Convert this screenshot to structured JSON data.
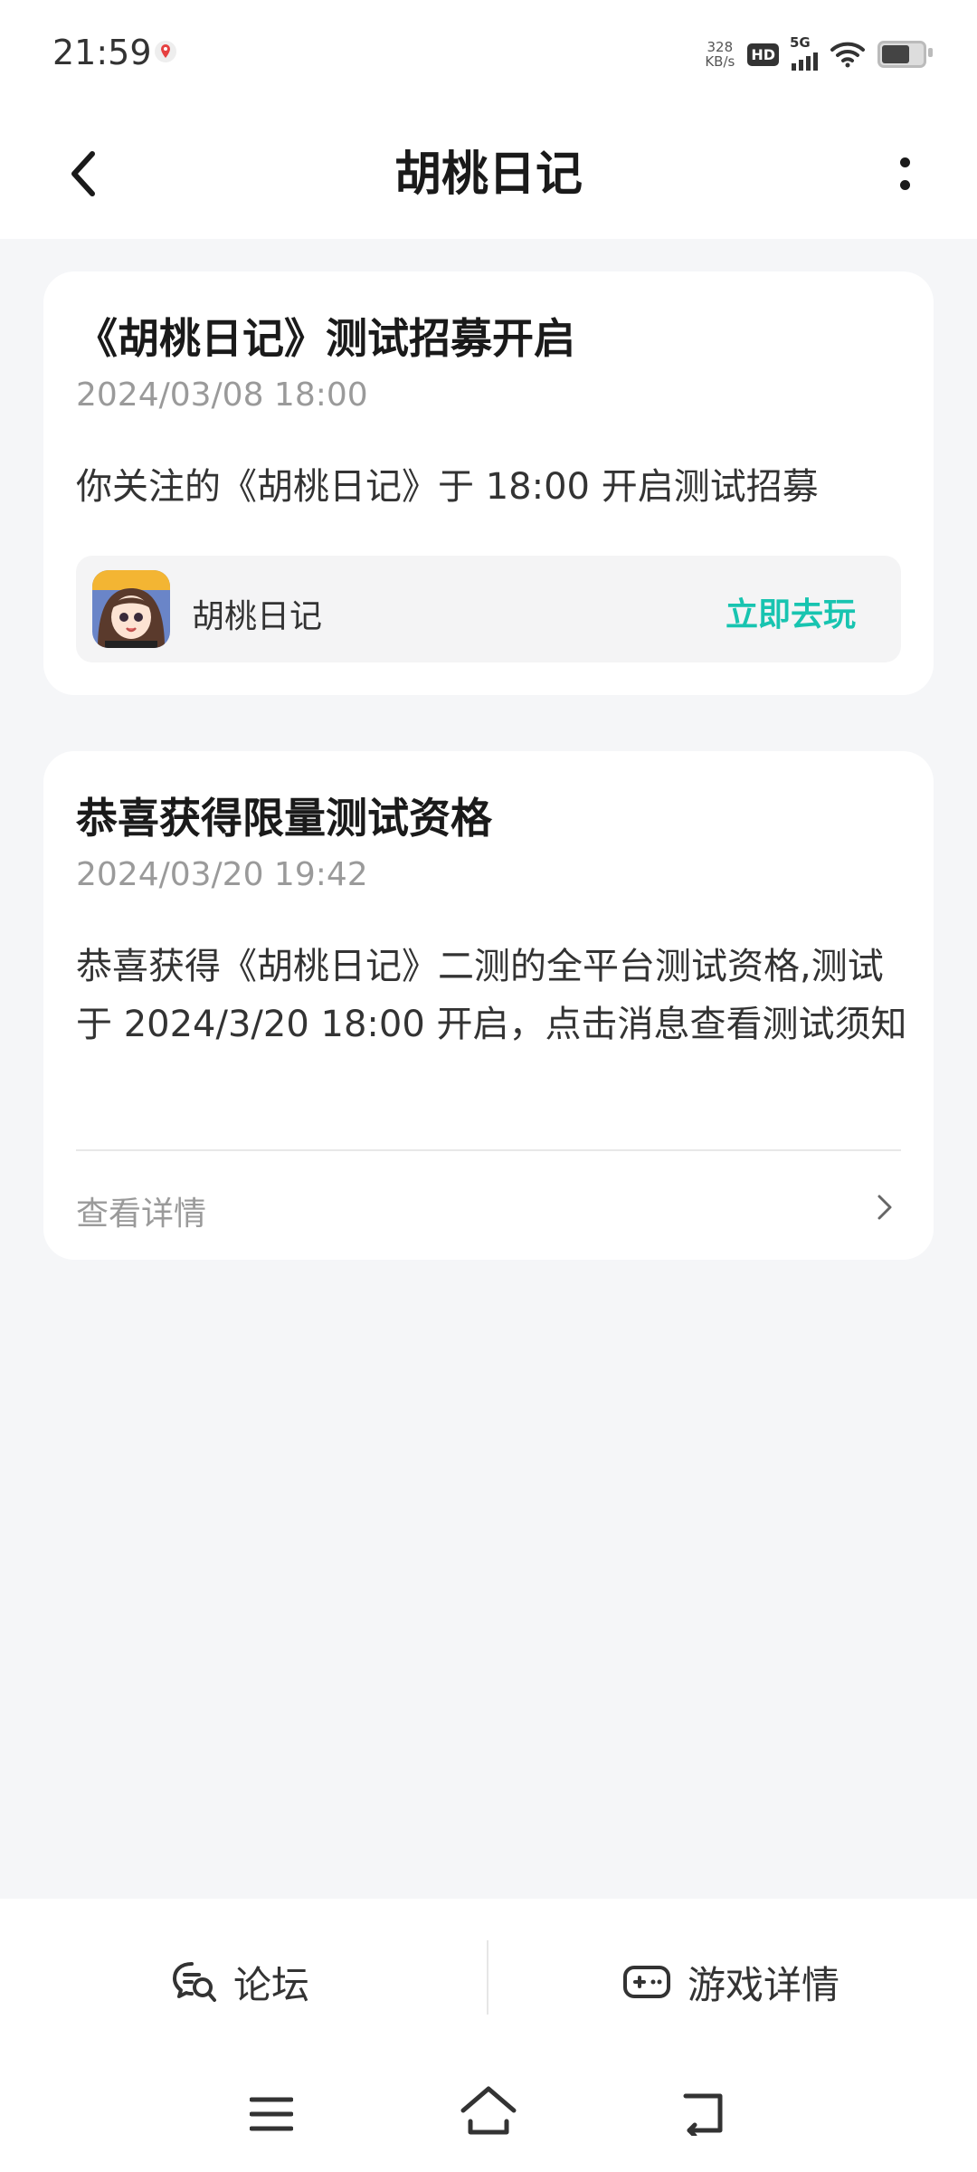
{
  "status_bar": {
    "time": "21:59",
    "net_speed_value": "328",
    "net_speed_unit": "KB/s",
    "hd_badge": "HD",
    "network_type": "5G",
    "icons": [
      "location-icon",
      "hd-icon",
      "signal-icon",
      "wifi-icon",
      "battery-icon"
    ]
  },
  "header": {
    "title": "胡桃日记",
    "back_icon": "back-arrow-icon",
    "more_icon": "more-vertical-icon"
  },
  "messages": [
    {
      "title": "《胡桃日记》测试招募开启",
      "time": "2024/03/08 18:00",
      "body": "你关注的《胡桃日记》于 18:00 开启测试招募",
      "game_name": "胡桃日记",
      "action_label": "立即去玩"
    },
    {
      "title": "恭喜获得限量测试资格",
      "time": "2024/03/20 19:42",
      "body": "恭喜获得《胡桃日记》二测的全平台测试资格,测试于 2024/3/20 18:00 开启，点击消息查看测试须知",
      "detail_label": "查看详情"
    }
  ],
  "bottom_bar": {
    "tabs": [
      {
        "label": "论坛",
        "icon": "forum-chat-icon"
      },
      {
        "label": "游戏详情",
        "icon": "gamepad-icon"
      }
    ]
  },
  "system_nav": {
    "icons": [
      "menu-icon",
      "home-icon",
      "back-icon"
    ]
  },
  "colors": {
    "accent": "#18c4b0",
    "background": "#f5f6f8",
    "card": "#ffffff",
    "secondary_text": "#9a9a9a"
  }
}
